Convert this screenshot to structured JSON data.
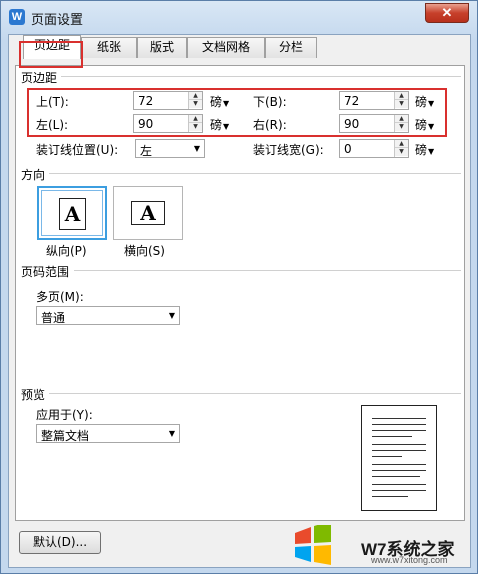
{
  "window": {
    "title": "页面设置",
    "close": "✕"
  },
  "tabs": [
    {
      "label": "页边距"
    },
    {
      "label": "纸张"
    },
    {
      "label": "版式"
    },
    {
      "label": "文档网格"
    },
    {
      "label": "分栏"
    }
  ],
  "margins": {
    "group_title": "页边距",
    "top": {
      "label": "上(T):",
      "value": "72",
      "unit": "磅"
    },
    "bottom": {
      "label": "下(B):",
      "value": "72",
      "unit": "磅"
    },
    "left": {
      "label": "左(L):",
      "value": "90",
      "unit": "磅"
    },
    "right": {
      "label": "右(R):",
      "value": "90",
      "unit": "磅"
    },
    "gutter_pos": {
      "label": "装订线位置(U):",
      "value": "左"
    },
    "gutter": {
      "label": "装订线宽(G):",
      "value": "0",
      "unit": "磅"
    }
  },
  "orientation": {
    "group_title": "方向",
    "portrait": {
      "label": "纵向(P)",
      "glyph": "A"
    },
    "landscape": {
      "label": "横向(S)",
      "glyph": "A"
    }
  },
  "pages": {
    "group_title": "页码范围",
    "multiple_label": "多页(M):",
    "multiple_value": "普通"
  },
  "preview": {
    "group_title": "预览",
    "apply_label": "应用于(Y):",
    "apply_value": "整篇文档"
  },
  "buttons": {
    "default": "默认(D)..."
  },
  "watermark": {
    "text": "W7系统之家",
    "url": "www.w7xitong.com"
  },
  "colors": {
    "highlight": "#d9302e",
    "selection": "#3c9ee0"
  }
}
